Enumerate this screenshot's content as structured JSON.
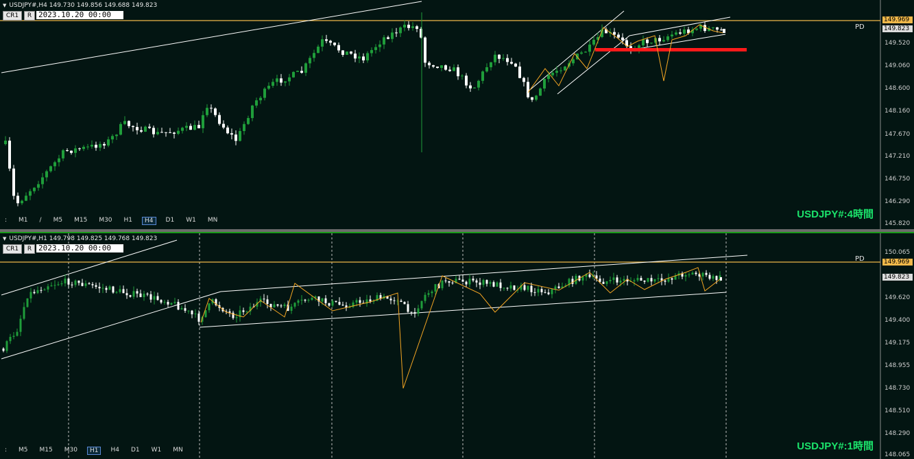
{
  "pane_h4": {
    "title": "USDJPY#,H4  149.730 149.856 149.688 149.823",
    "cr_label": "CR1",
    "r_label": "R",
    "date": "2023.10.20 00:00",
    "timeframes": [
      ":",
      "M1",
      "/",
      "M5",
      "M15",
      "M30",
      "H1",
      "H4",
      "D1",
      "W1",
      "MN"
    ],
    "selected_tf": "H4",
    "label": "USDJPY#:4時間",
    "pd": "PD",
    "ticks": [
      "149.520",
      "149.060",
      "148.600",
      "148.160",
      "147.670",
      "147.210",
      "146.750",
      "146.290",
      "145.820"
    ],
    "price_line": "149.969",
    "current_price": "149.823"
  },
  "pane_h1": {
    "title": "USDJPY#,H1  149.798 149.825 149.768 149.823",
    "cr_label": "CR1",
    "r_label": "R",
    "date": "2023.10.20 00:00",
    "timeframes": [
      ":",
      "M5",
      "M15",
      "M30",
      "H1",
      "H4",
      "D1",
      "W1",
      "MN"
    ],
    "selected_tf": "H1",
    "label": "USDJPY#:1時間",
    "pd": "PD",
    "ticks": [
      "150.065",
      "149.620",
      "149.400",
      "149.175",
      "148.955",
      "148.730",
      "148.510",
      "148.290",
      "148.065"
    ],
    "price_line": "149.969",
    "current_price": "149.823"
  },
  "colors": {
    "background": "#031512",
    "bull_candle": "#1f9d3a",
    "bear_candle": "#ffffff",
    "price_line": "#f0b84a",
    "zigzag": "#f5a623",
    "resistance": "#ff1a1a",
    "channel": "#ffffff",
    "label": "#1be36b"
  }
}
